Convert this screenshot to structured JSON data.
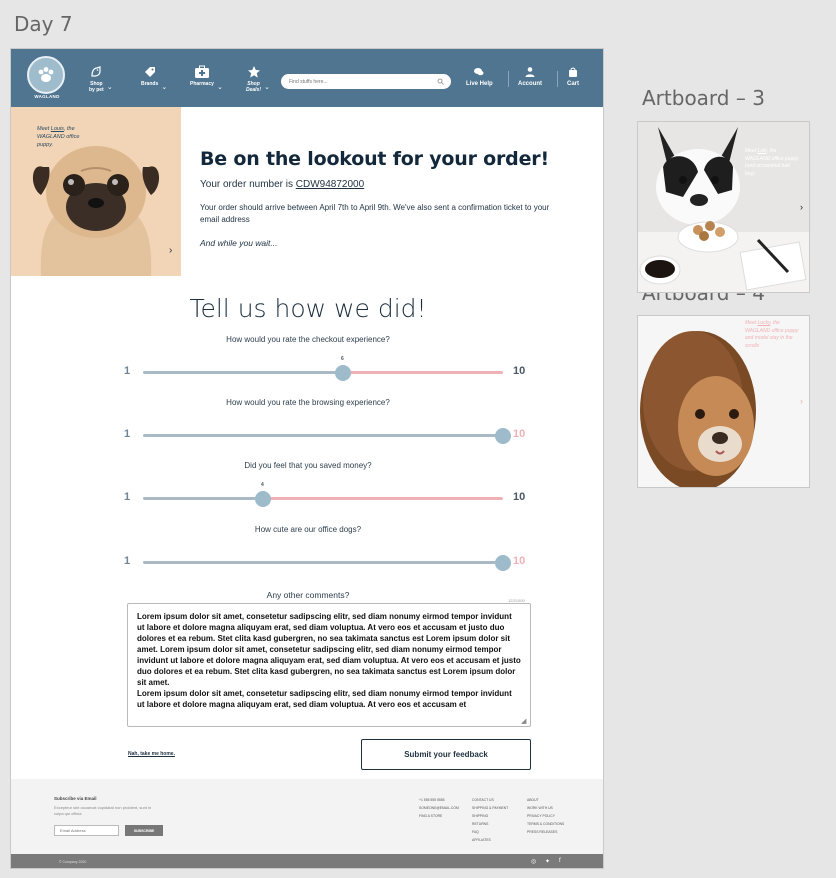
{
  "canvas": {
    "day_title": "Day 7",
    "artboard3_title": "Artboard – 3",
    "artboard4_title": "Artboard – 4"
  },
  "nav": {
    "logo_text": "WAGLAND",
    "items": [
      {
        "label": "Shop\nby pet",
        "icon": "pet-icon",
        "dropdown": true
      },
      {
        "label": "Brands",
        "icon": "tag-icon",
        "dropdown": true
      },
      {
        "label": "Pharmacy",
        "icon": "medical-kit-icon",
        "dropdown": true
      },
      {
        "label": "Shop\nDeals!",
        "icon": "star-icon",
        "dropdown": true
      }
    ],
    "search_placeholder": "Find stuffs here...",
    "live_help": "Live Help",
    "account": "Account",
    "cart": "Cart"
  },
  "hero": {
    "caption_prefix": "Meet ",
    "caption_name": "Louis",
    "caption_suffix": ", the WAGLAND office puppy.",
    "title": "Be on the lookout for your order!",
    "order_prefix": "Your order number is ",
    "order_number": "CDW94872000",
    "arrival_text": "Your order should arrive between April 7th to April 9th. We've also sent a confirmation ticket to your email address",
    "wait_text": "And while you wait..."
  },
  "survey": {
    "title": "Tell us how we did!",
    "questions": [
      {
        "label": "How would you rate the checkout experience?",
        "min": "1",
        "max": "10",
        "value": 6
      },
      {
        "label": "How would you rate the browsing experience?",
        "min": "1",
        "max": "10",
        "value": 10
      },
      {
        "label": "Did you feel that you saved money?",
        "min": "1",
        "max": "10",
        "value": 4
      },
      {
        "label": "How cute are our office dogs?",
        "min": "1",
        "max": "10",
        "value": 10
      }
    ],
    "comments_label": "Any other comments?",
    "char_count": "122/1000",
    "comments_text": "Lorem ipsum dolor sit amet, consetetur sadipscing elitr, sed diam nonumy eirmod tempor invidunt ut labore et dolore magna aliquyam erat, sed diam voluptua. At vero eos et accusam et justo duo dolores et ea rebum. Stet clita kasd gubergren, no sea takimata sanctus est Lorem ipsum dolor sit amet. Lorem ipsum dolor sit amet, consetetur sadipscing elitr, sed diam nonumy eirmod tempor invidunt ut labore et dolore magna aliquyam erat, sed diam voluptua. At vero eos et accusam et justo duo dolores et ea rebum. Stet clita kasd gubergren, no sea takimata sanctus est Lorem ipsum dolor sit amet.\nLorem ipsum dolor sit amet, consetetur sadipscing elitr, sed diam nonumy eirmod tempor invidunt ut labore et dolore magna aliquyam erat, sed diam voluptua. At vero eos et accusam et",
    "nah_link": "Nah, take me home.",
    "submit_label": "Submit your feedback"
  },
  "footer": {
    "subscribe_title": "Subscribe via Email",
    "subscribe_text": "Excepteur sint occaecat cupidatat non proident, sunt in culpa qui officia",
    "email_placeholder": "Email Address",
    "subscribe_button": "SUBSCRIBE",
    "col1": [
      "+1 555 555 5555",
      "SOMEONE@EMAIL.COM",
      "FIND A STORE"
    ],
    "col2": [
      "CONTACT US",
      "SHIPPING & PAYMENT",
      "SHIPPING",
      "RETURNS",
      "FAQ",
      "AFFILIATES"
    ],
    "col3": [
      "ABOUT",
      "WORK WITH US",
      "PRIVACY POLICY",
      "TERMS & CONDITIONS",
      "PRESS RELEASES"
    ],
    "copyright": "© Company 2020"
  },
  "side_boards": {
    "ab3_caption_prefix": "Meet ",
    "ab3_caption_name": "Loki",
    "ab3_caption_suffix": ", the WAGLAND office puppy (and occasional bad boy).",
    "ab4_caption_prefix": "Meet ",
    "ab4_caption_name": "Lucky",
    "ab4_caption_suffix": ", the WAGLAND office puppy and model stay in the scrolls"
  },
  "colors": {
    "nav_bg": "#4f7590",
    "slider_left": "#a9bac6",
    "slider_right": "#efb1b6",
    "thumb": "#9dbbcb"
  }
}
